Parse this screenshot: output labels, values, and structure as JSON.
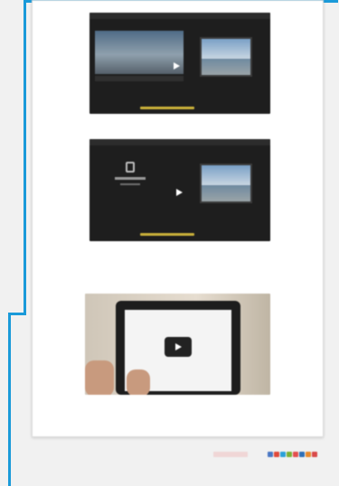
{
  "captions": {
    "top": "",
    "fig2": "",
    "para_line1": "",
    "para_line2": "",
    "fig3": "",
    "end": ""
  },
  "fig1": {
    "window_title": ""
  },
  "fig2": {
    "window_title": ""
  },
  "footer": {
    "left_line1": "",
    "left_line2": "",
    "brand_label": ""
  },
  "colors": {
    "accent": "#1a9ad9",
    "progress": "#c9b03a",
    "social": [
      "#4b78c4",
      "#e04a3b",
      "#2aa0d8",
      "#7bb135",
      "#e34f4f"
    ]
  }
}
